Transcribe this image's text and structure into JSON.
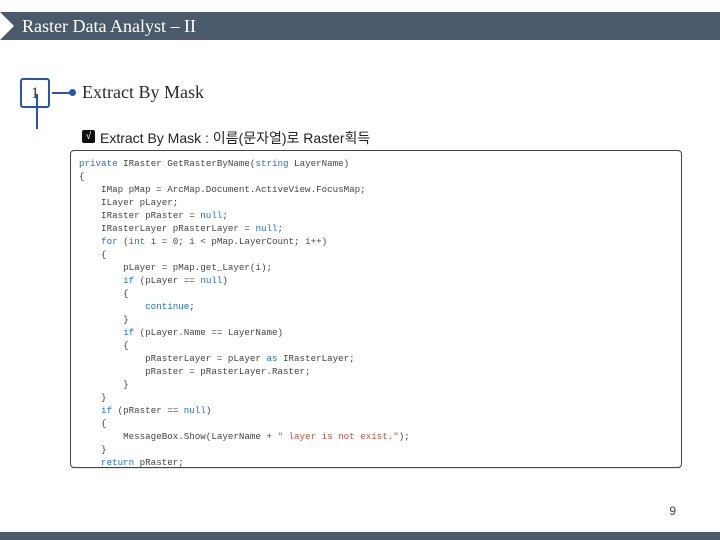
{
  "header": {
    "title": "Raster Data Analyst – II"
  },
  "step": {
    "number": "1",
    "section_title": "Extract By Mask"
  },
  "subhead": {
    "bullet_glyph": "√",
    "text": "Extract By Mask : 이름(문자열)로 Raster획득"
  },
  "code": {
    "l01a": "private",
    "l01b": " IRaster GetRasterByName(",
    "l01c": "string",
    "l01d": " LayerName)",
    "l02": "{",
    "l03": "    IMap pMap = ArcMap.Document.ActiveView.FocusMap;",
    "l04": "    ILayer pLayer;",
    "l05a": "    IRaster pRaster = ",
    "l05b": "null",
    "l05c": ";",
    "l06a": "    IRasterLayer pRasterLayer = ",
    "l06b": "null",
    "l06c": ";",
    "l07a": "    for",
    "l07b": " (",
    "l07c": "int",
    "l07d": " i = 0; i < pMap.LayerCount; i++)",
    "l08": "    {",
    "l09": "        pLayer = pMap.get_Layer(i);",
    "l10a": "        if",
    "l10b": " (pLayer == ",
    "l10c": "null",
    "l10d": ")",
    "l11": "        {",
    "l12a": "            continue",
    "l12b": ";",
    "l13": "        }",
    "l14a": "        if",
    "l14b": " (pLayer.Name == LayerName)",
    "l15": "        {",
    "l16a": "            pRasterLayer = pLayer ",
    "l16b": "as",
    "l16c": " IRasterLayer;",
    "l17": "            pRaster = pRasterLayer.Raster;",
    "l18": "        }",
    "l19": "    }",
    "l20a": "    if",
    "l20b": " (pRaster == ",
    "l20c": "null",
    "l20d": ")",
    "l21": "    {",
    "l22a": "        MessageBox.Show(LayerName + ",
    "l22b": "\" layer is not exist.\"",
    "l22c": ");",
    "l23": "    }",
    "l24a": "    return",
    "l24b": " pRaster;",
    "l25": "}"
  },
  "footer": {
    "page": "9"
  }
}
